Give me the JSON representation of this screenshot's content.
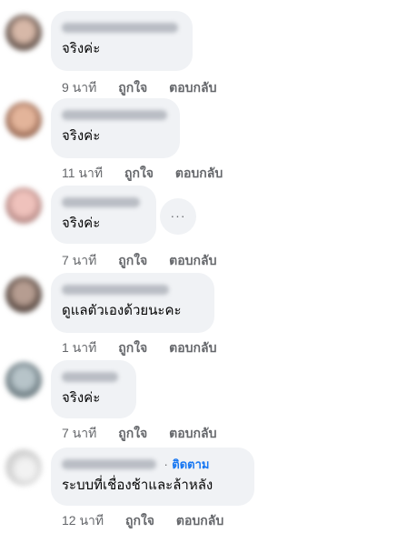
{
  "comments": [
    {
      "text": "จริงค่ะ",
      "time": "9 นาที",
      "like": "ถูกใจ",
      "reply": "ตอบกลับ",
      "avatar_color": "#7a6a62"
    },
    {
      "text": "จริงค่ะ",
      "time": "11 นาที",
      "like": "ถูกใจ",
      "reply": "ตอบกลับ",
      "avatar_color": "#b07a5e"
    },
    {
      "text": "จริงค่ะ",
      "time": "7 นาที",
      "like": "ถูกใจ",
      "reply": "ตอบกลับ",
      "avatar_color": "#c98f8a"
    },
    {
      "text": "ดูแลตัวเองด้วยนะคะ",
      "time": "1 นาที",
      "like": "ถูกใจ",
      "reply": "ตอบกลับ",
      "avatar_color": "#6b5a52"
    },
    {
      "text": "จริงค่ะ",
      "time": "7 นาที",
      "like": "ถูกใจ",
      "reply": "ตอบกลับ",
      "avatar_color": "#7b8a90"
    },
    {
      "text": "ระบบที่เชื่องช้าและล้าหลัง",
      "time": "12 นาที",
      "like": "ถูกใจ",
      "reply": "ตอบกลับ",
      "follow_sep": "·",
      "follow": "ติดตาม",
      "avatar_color": "#d9d9d9"
    }
  ],
  "more_options": {
    "glyph": "···",
    "icon": "more-horizontal-icon"
  }
}
